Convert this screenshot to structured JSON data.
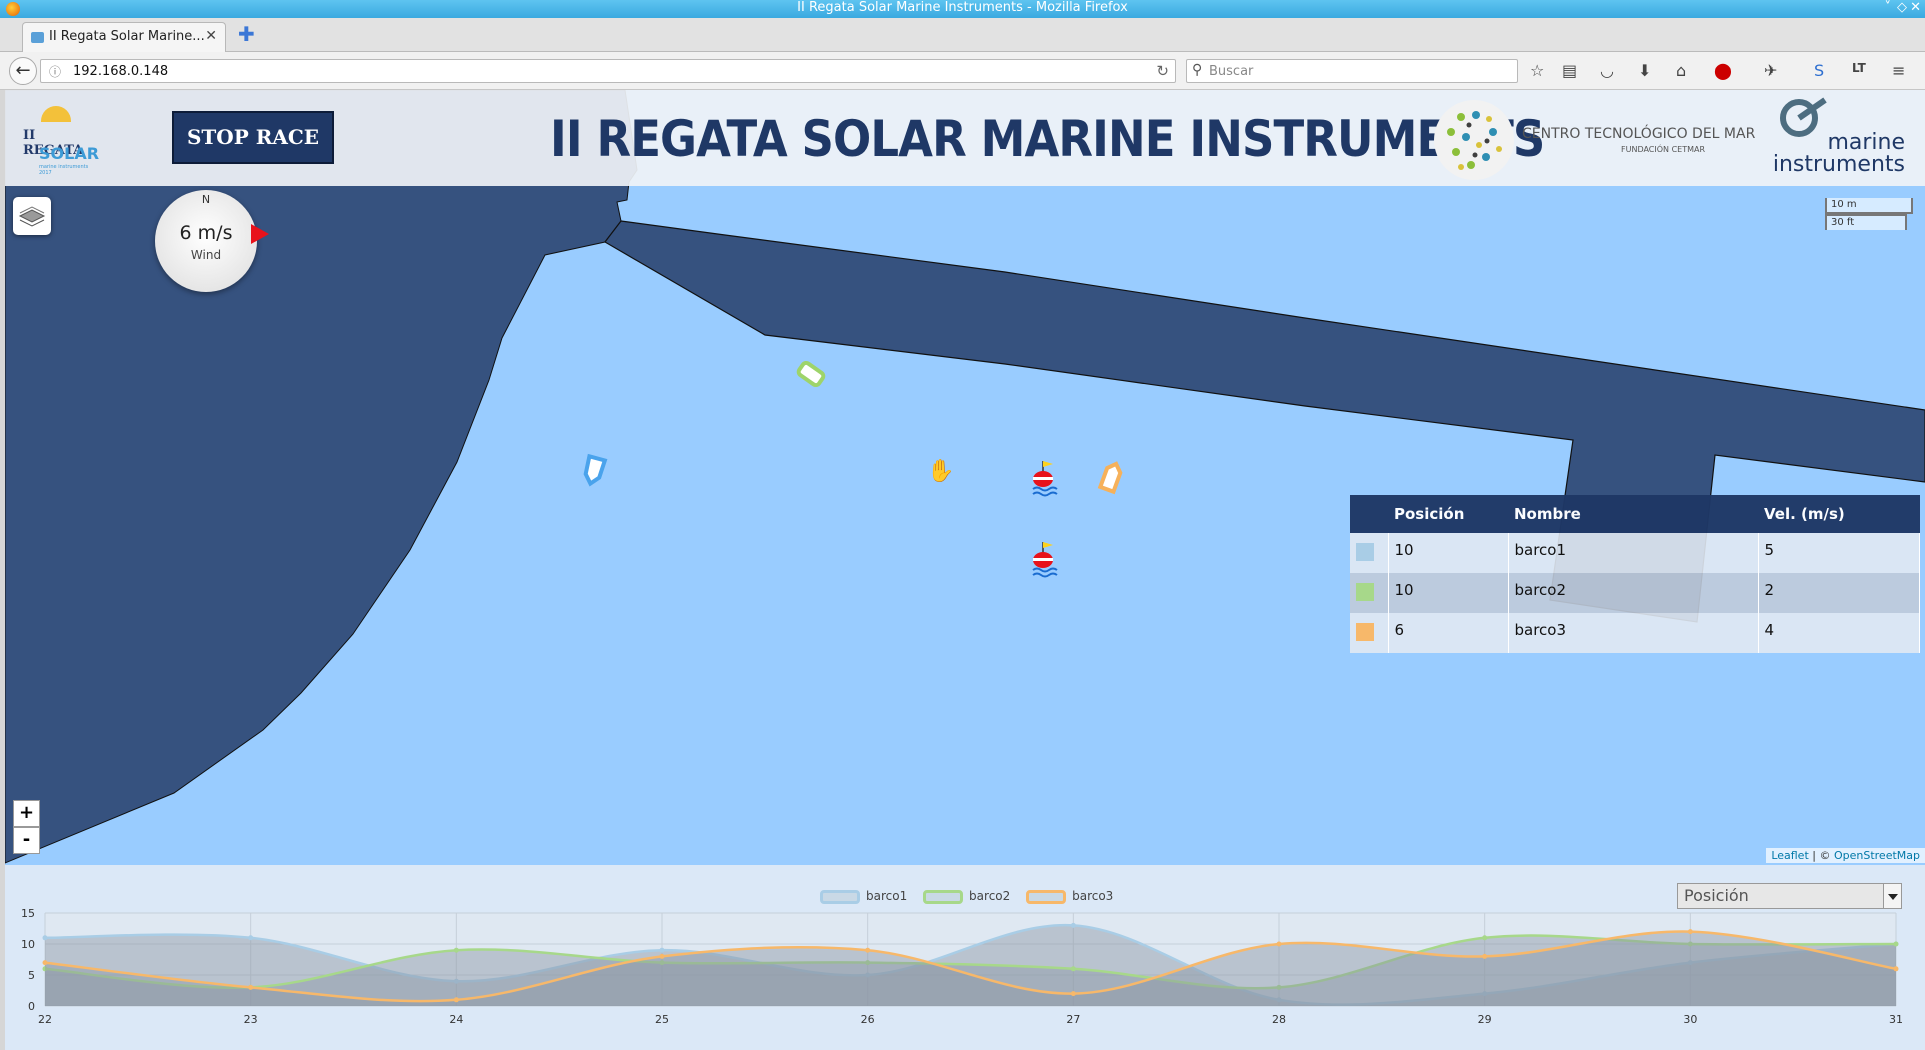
{
  "browser": {
    "window_title": "II Regata Solar Marine Instruments - Mozilla Firefox",
    "tab_title": "II Regata Solar Marine...",
    "url": "192.168.0.148",
    "search_placeholder": "Buscar"
  },
  "header": {
    "logo_line1": "II REGATA",
    "logo_line2": "SOLAR",
    "logo_line3": "marine instruments 2017",
    "stop_button": "STOP RACE",
    "title": "II REGATA SOLAR MARINE INSTRUMENTS",
    "partner1_name": "CENTRO TECNOLÓGICO DEL MAR",
    "partner1_sub": "FUNDACIÓN CETMAR",
    "partner2_line1": "marine",
    "partner2_line2": "instruments"
  },
  "map": {
    "wind": {
      "north": "N",
      "speed": "6 m/s",
      "label": "Wind"
    },
    "scale": {
      "metric": "10 m",
      "imperial": "30 ft"
    },
    "zoom_in": "+",
    "zoom_out": "-",
    "attribution_leaflet": "Leaflet",
    "attribution_sep": " | © ",
    "attribution_osm": "OpenStreetMap",
    "boats": [
      {
        "name": "barco1",
        "color": "#4aa3ec"
      },
      {
        "name": "barco2",
        "color": "#9ed46a"
      },
      {
        "name": "barco3",
        "color": "#f6b15a"
      }
    ]
  },
  "ranking": {
    "headers": [
      "Posición",
      "Nombre",
      "Vel. (m/s)"
    ],
    "rows": [
      {
        "color": "#a9cde6",
        "position": "10",
        "name": "barco1",
        "speed": "5"
      },
      {
        "color": "#a7d88a",
        "position": "10",
        "name": "barco2",
        "speed": "2"
      },
      {
        "color": "#f7b86a",
        "position": "6",
        "name": "barco3",
        "speed": "4"
      }
    ]
  },
  "metric_select": {
    "selected": "Posición"
  },
  "chart_data": {
    "type": "area",
    "x": [
      22,
      23,
      24,
      25,
      26,
      27,
      28,
      29,
      30,
      31
    ],
    "ylim": [
      0,
      15
    ],
    "yticks": [
      0,
      5,
      10,
      15
    ],
    "legend_position": "top-center",
    "series": [
      {
        "name": "barco1",
        "color": "#a9cde6",
        "values": [
          11,
          11,
          4,
          9,
          5,
          13,
          1,
          2,
          7,
          10
        ]
      },
      {
        "name": "barco2",
        "color": "#a7d88a",
        "values": [
          6,
          3,
          9,
          7,
          7,
          6,
          3,
          11,
          10,
          10
        ]
      },
      {
        "name": "barco3",
        "color": "#f7b86a",
        "values": [
          7,
          3,
          1,
          8,
          9,
          2,
          10,
          8,
          12,
          6
        ]
      }
    ]
  }
}
